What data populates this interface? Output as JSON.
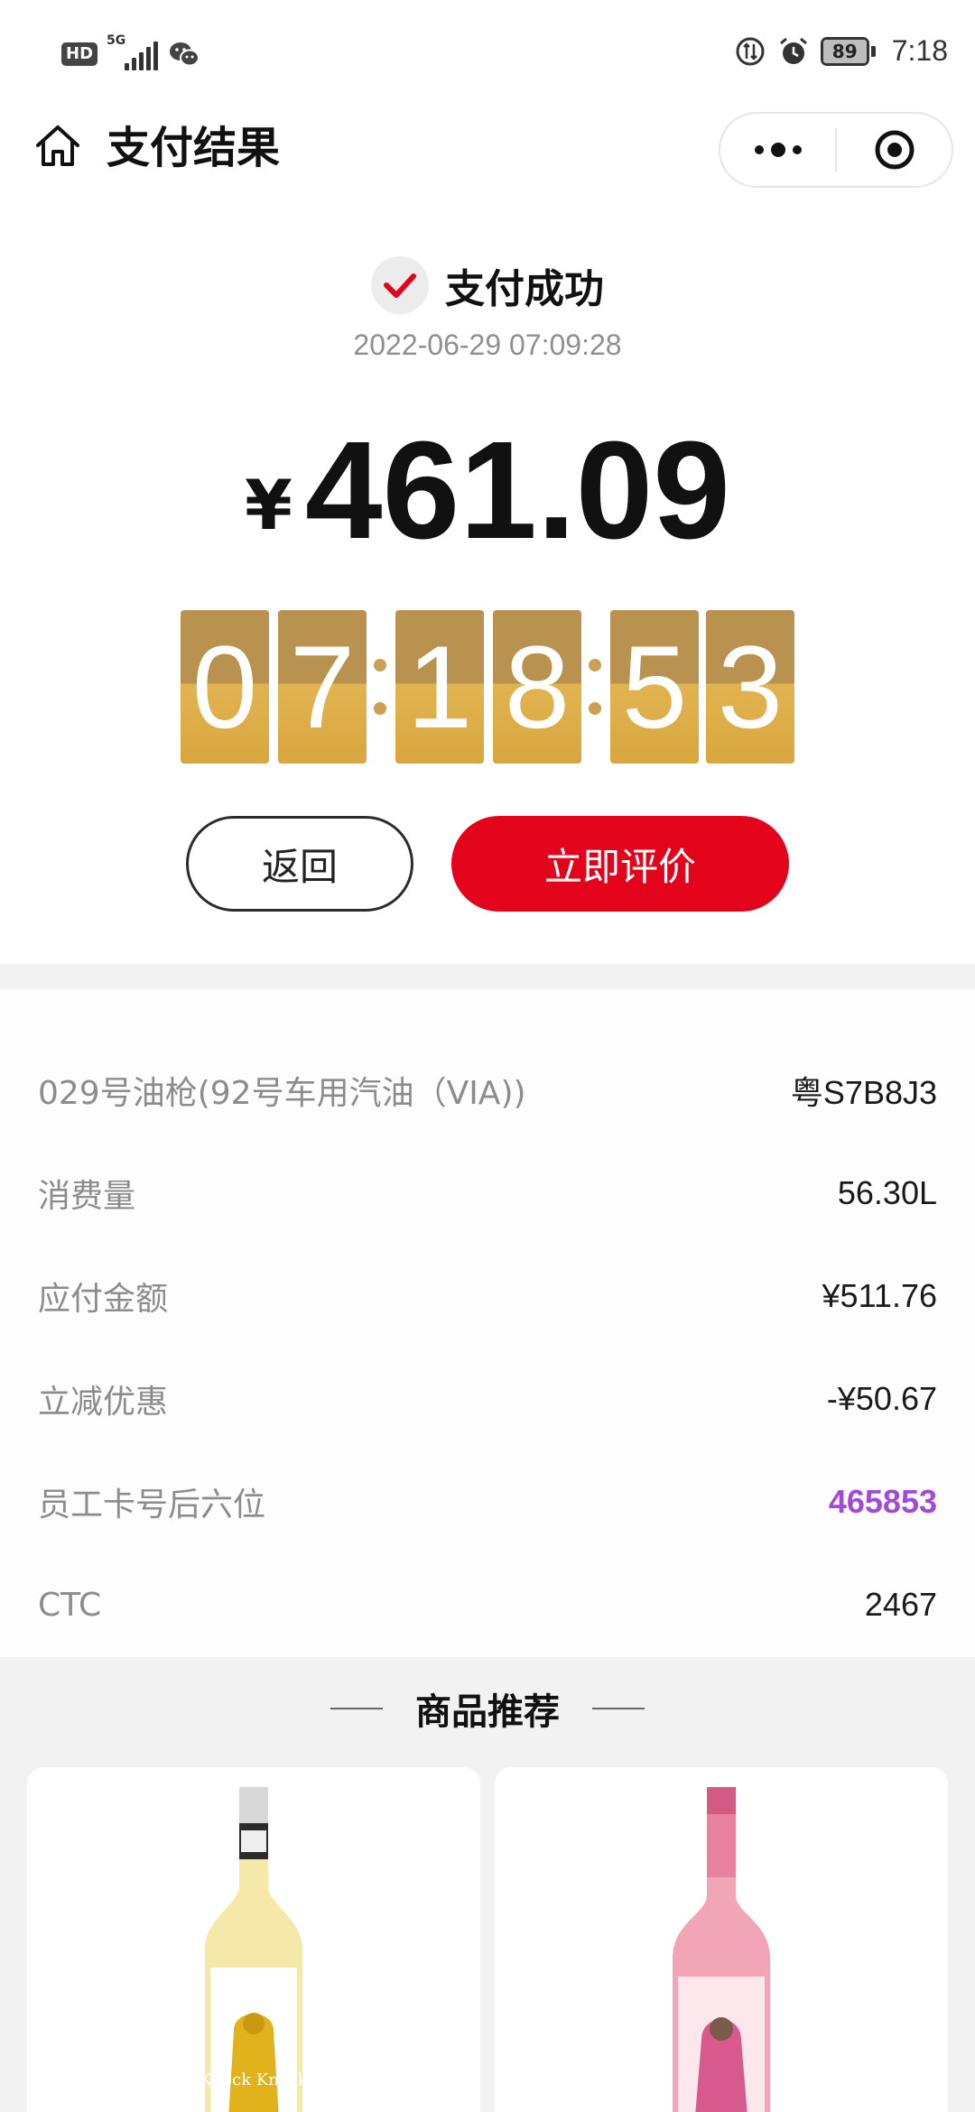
{
  "status_bar": {
    "hd": "HD",
    "network": "5G",
    "battery": "89",
    "time": "7:18"
  },
  "nav": {
    "title": "支付结果"
  },
  "result": {
    "status": "支付成功",
    "time": "2022-06-29 07:09:28",
    "currency": "¥",
    "amount": "461.09"
  },
  "clock": {
    "digits": [
      "0",
      "7",
      "1",
      "8",
      "5",
      "3"
    ]
  },
  "buttons": {
    "back": "返回",
    "review": "立即评价"
  },
  "details": [
    {
      "label": "029号油枪(92号车用汽油（VIA))",
      "value": "粤S7B8J3"
    },
    {
      "label": "消费量",
      "value": "56.30L"
    },
    {
      "label": "应付金额",
      "value": "¥511.76"
    },
    {
      "label": "立减优惠",
      "value": "-¥50.67"
    },
    {
      "label": "员工卡号后六位",
      "value": "465853"
    },
    {
      "label": "CTC",
      "value": "2467"
    }
  ],
  "recommend": {
    "title": "商品推荐",
    "products": [
      {
        "image": "white-wine-bottle-yellow-hood",
        "label_text": "Knock Knock"
      },
      {
        "image": "rose-wine-bottle-pink-hood"
      }
    ]
  },
  "colors": {
    "accent_red": "#e3041b",
    "clock_gold": "#d9a63e",
    "highlight_purple": "#a349d8"
  }
}
